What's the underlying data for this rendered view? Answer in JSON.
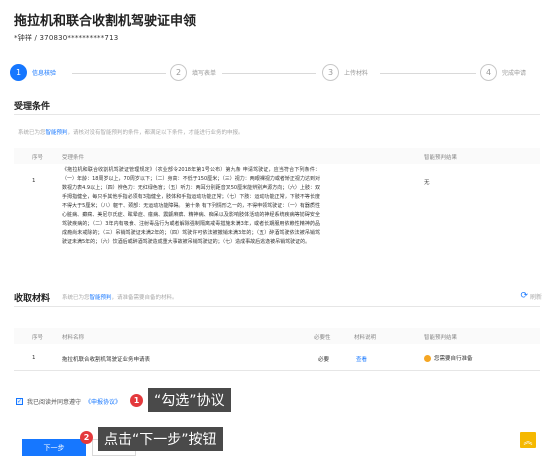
{
  "page": {
    "title": "拖拉机和联合收割机驾驶证申领",
    "user_id": "*钟祥 / 370830**********713"
  },
  "steps": [
    {
      "num": "1",
      "label": "信息核验"
    },
    {
      "num": "2",
      "label": "填写表单"
    },
    {
      "num": "3",
      "label": "上传材料"
    },
    {
      "num": "4",
      "label": "完成申请"
    }
  ],
  "conditions": {
    "title": "受理条件",
    "hint_pre": "系统已为您",
    "hint_link": "智能预判",
    "hint_post": "，请核对没有智能预判的条件，都满足以下条件，才能进行业务的申报。",
    "col_index": "序号",
    "col_condition": "受理条件",
    "col_result": "智能预判结果",
    "row_index": "1",
    "row_text": "《拖拉机和联合收割机驾驶证管理规定》（农业部令2018年第1号公布）第九条 申请驾驶证，应当符合下列条件：（一）年龄：18周岁以上，70周岁以下；（二）身高：不低于150厘米；（三）视力：两眼裸视力或者矫正视力达到对数视力表4.9以上；（四）辨色力：无红绿色盲；（五）听力：两耳分别距音叉50厘米能辨别声源方向；（六）上肢：双手拇指健全，每只手其他手指必须有3指健全，肢体和手指运动功能正常；（七）下肢：运动功能正常，下肢不等长度不得大于5厘米；（八）躯干、颈部：无运动功能障碍。 第十条 有下列情形之一的，不得申领驾驶证：（一）有器质性心脏病、癫痫、美尼尔氏症、眩晕症、癔病、震颤麻痹、精神病、痴呆以及影响肢体活动的神经系统疾病等妨碍安全驾驶疾病的；（二）3年内有吸食、注射毒品行为或者解除强制隔离戒毒措施未满3年，或者长期服用依赖性精神药品成瘾尚未戒除的；（三）吊销驾驶证未满2年的；（四）驾驶许可依法被撤销未满3年的；（五）醉酒驾驶依法被吊销驾驶证未满5年的；（六）饮酒后或醉酒驾驶造成重大事故被吊销驾驶证的；（七）造成事故后逃逸被吊销驾驶证的。",
    "row_result": "无"
  },
  "materials": {
    "title": "收取材料",
    "hint_pre": "系统已为您",
    "hint_link": "智能预判",
    "hint_post": "，请准备需要自备的材料。",
    "refresh_label": "刷新",
    "col_index": "序号",
    "col_name": "材料名称",
    "col_required": "必要性",
    "col_desc": "材料说明",
    "col_result": "智能预判结果",
    "row_index": "1",
    "row_name": "拖拉机联合收割机驾驶证业务申请表",
    "row_required": "必要",
    "row_desc": "查看",
    "row_result": "您需要自行准备"
  },
  "agreement": {
    "prefix": "我已阅读并同意遵守",
    "link": "《申报协议》"
  },
  "buttons": {
    "next": "下一步"
  },
  "annotations": [
    {
      "num": "1",
      "text": "“勾选”协议"
    },
    {
      "num": "2",
      "text": "点击“下一步”按钮"
    }
  ],
  "colors": {
    "accent": "#1677ff",
    "badge": "#e4393c",
    "warning": "#f5a623"
  }
}
